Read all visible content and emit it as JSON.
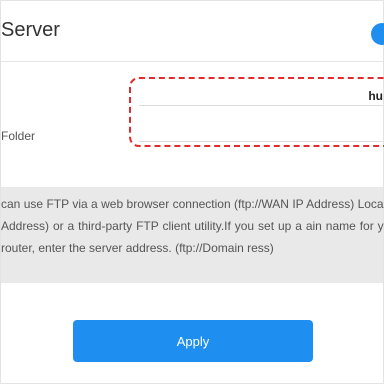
{
  "header": {
    "title": "Server"
  },
  "form": {
    "field1_label": "",
    "field1_value": "hu",
    "field2_label": "Folder"
  },
  "note": {
    "text": "can use FTP via a web browser connection (ftp://WAN IP Address) Local IP Address) or a third-party FTP client utility.If you set up a ain name for your router, enter the server address. (ftp://Domain ress)"
  },
  "actions": {
    "apply_label": "Apply"
  },
  "colors": {
    "accent": "#1e8ff0",
    "highlight": "#e32b2b"
  }
}
